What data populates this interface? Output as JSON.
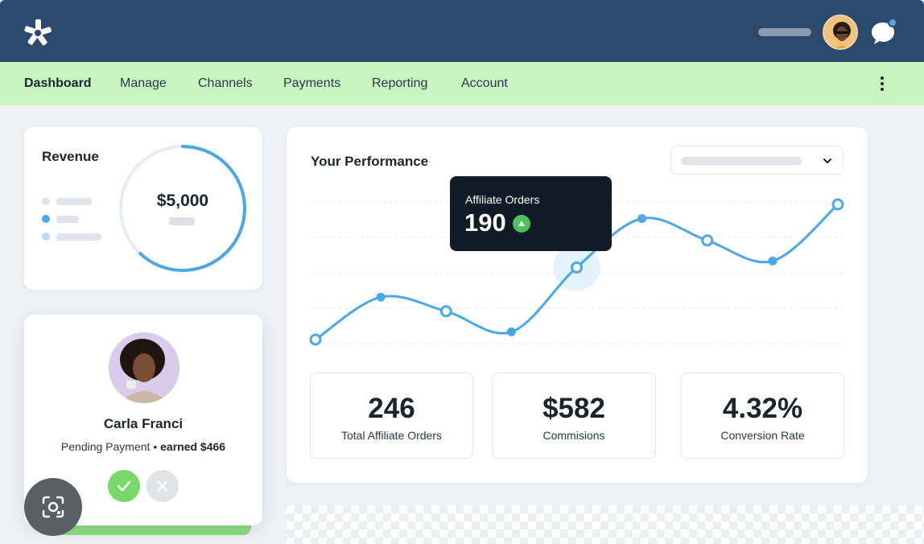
{
  "nav": {
    "items": [
      {
        "label": "Dashboard",
        "active": true
      },
      {
        "label": "Manage"
      },
      {
        "label": "Channels"
      },
      {
        "label": "Payments"
      },
      {
        "label": "Reporting"
      },
      {
        "label": "Account"
      }
    ]
  },
  "topbar": {
    "logo_icon": "asterisk-logo-icon",
    "chat_icon": "chat-bubble-icon",
    "menu_icon": "kebab-menu-icon"
  },
  "revenue": {
    "title": "Revenue",
    "value": "$5,000",
    "progress": 0.62,
    "legend_colors": [
      "#e1e4ea",
      "#4aa8e8",
      "#b9dcf5"
    ]
  },
  "profile": {
    "name": "Carla Franci",
    "status": "Pending Payment",
    "separator": "•",
    "earned": "earned $466",
    "approve_icon": "check-icon",
    "reject_icon": "close-icon"
  },
  "performance": {
    "title": "Your Performance",
    "tooltip": {
      "label": "Affiliate Orders",
      "value": "190",
      "trend_icon": "arrow-up-icon"
    },
    "stats": [
      {
        "value": "246",
        "label": "Total Affiliate Orders"
      },
      {
        "value": "$582",
        "label": "Commisions"
      },
      {
        "value": "4.32%",
        "label": "Conversion Rate"
      }
    ]
  },
  "chart_data": {
    "type": "line",
    "x": [
      0,
      1,
      2,
      3,
      4,
      5,
      6,
      7,
      8
    ],
    "series": [
      {
        "values": [
          10,
          43,
          32,
          16,
          66,
          104,
          87,
          71,
          115
        ],
        "color": "#4aa8e8"
      }
    ],
    "highlighted_index": 4,
    "hollow_points": [
      0,
      2,
      4,
      6,
      8
    ],
    "ylim": [
      0,
      130
    ],
    "grid": true
  },
  "colors": {
    "topbar": "#2c4a6e",
    "navbar": "#c8f5c0",
    "accent": "#4aa8e8",
    "approve": "#78d86a"
  }
}
